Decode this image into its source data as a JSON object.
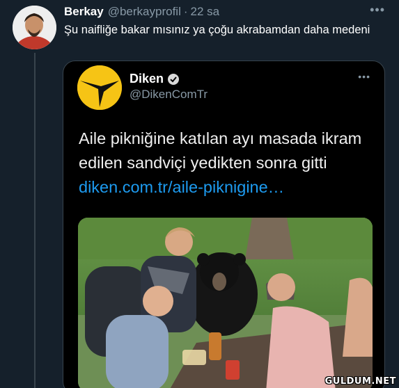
{
  "tweet": {
    "author_name": "Berkay",
    "author_handle": "@berkayprofil",
    "separator": "·",
    "time": "22 sa",
    "more_icon": "more-horizontal-icon",
    "text": "Şu naifliğe bakar mısınız ya çoğu akrabamdan daha medeni"
  },
  "quoted": {
    "author_name": "Diken",
    "author_handle": "@DikenComTr",
    "verified": true,
    "text": "Aile pikniğine katılan ayı masada ikram edilen sandviçi yedikten sonra gitti ",
    "link_text": "diken.com.tr/aile-piknigine…",
    "logo_color": "#f6c415",
    "link_color": "#1d9bf0"
  },
  "watermark": "GULDUM.NET"
}
